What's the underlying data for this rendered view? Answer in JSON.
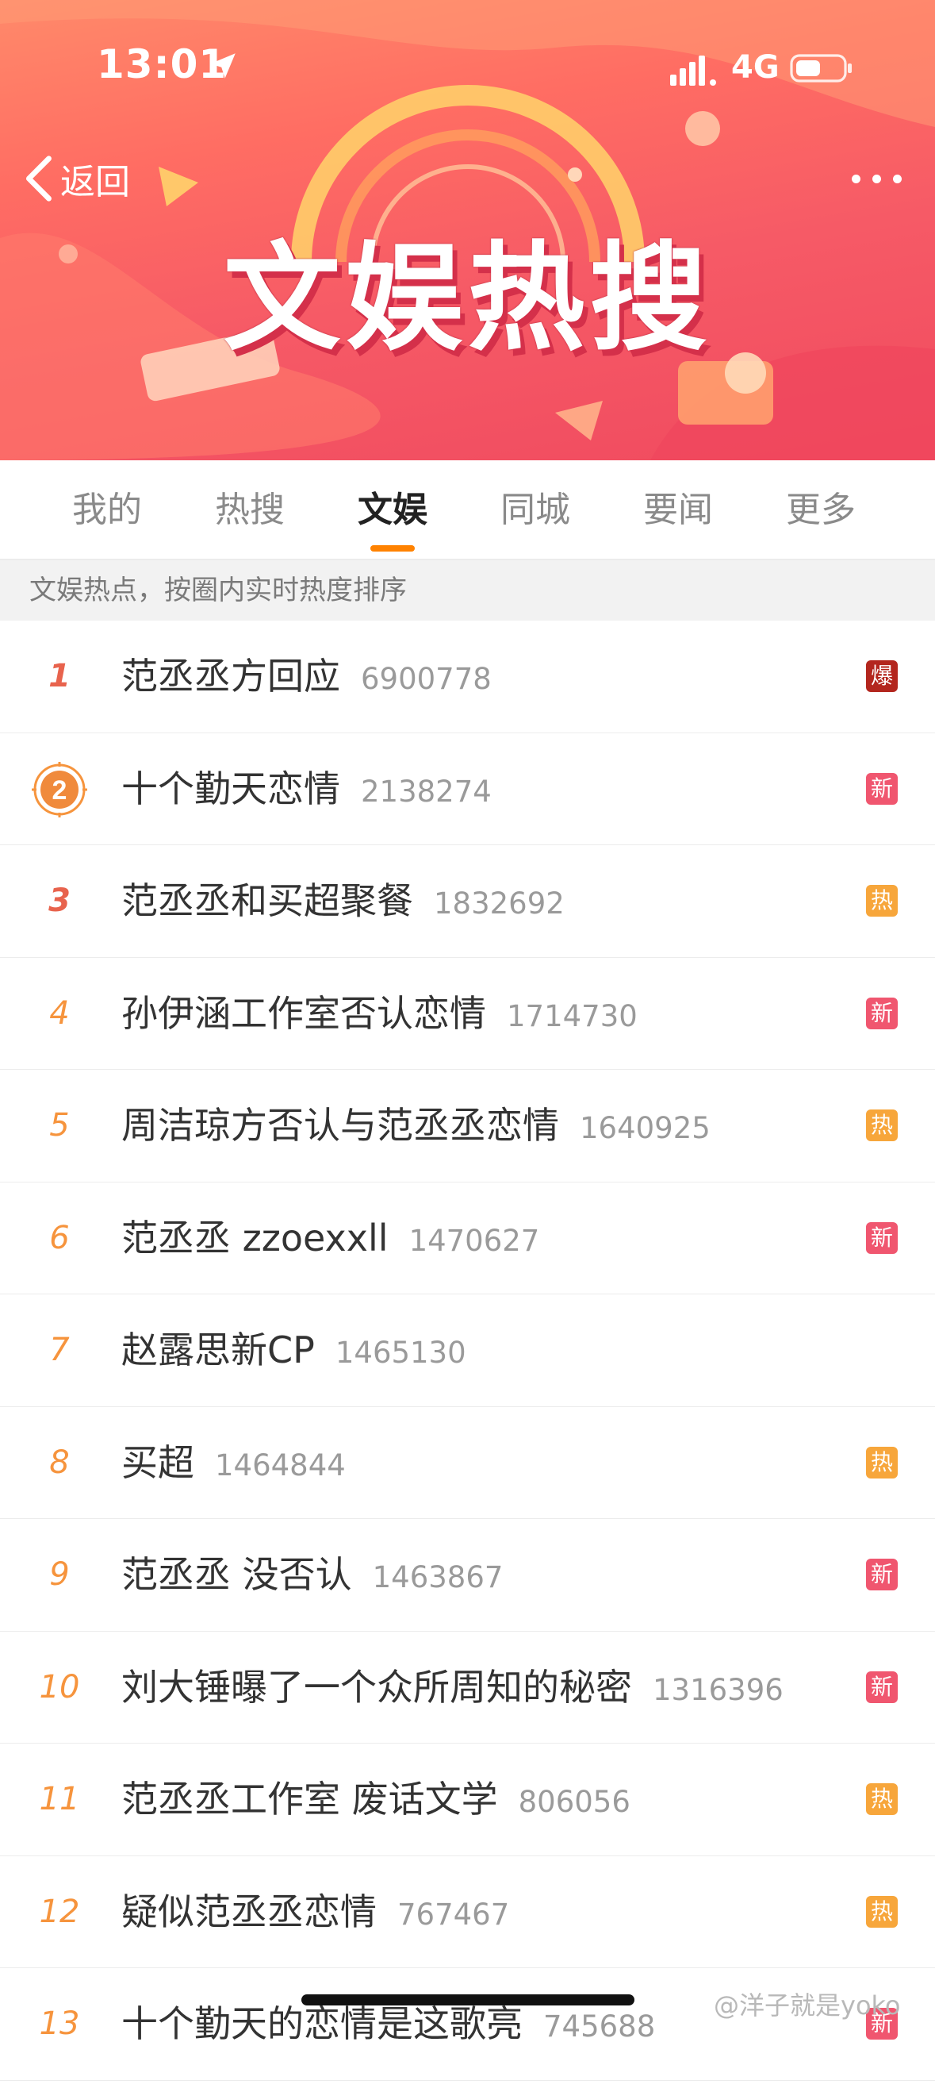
{
  "status_bar": {
    "time": "13:01",
    "network": "4G"
  },
  "header": {
    "back_label": "返回",
    "banner_title": "文娱热搜"
  },
  "tabs": [
    {
      "label": "我的",
      "active": false
    },
    {
      "label": "热搜",
      "active": false
    },
    {
      "label": "文娱",
      "active": true
    },
    {
      "label": "同城",
      "active": false
    },
    {
      "label": "要闻",
      "active": false
    },
    {
      "label": "更多",
      "active": false
    }
  ],
  "subheader": "文娱热点，按圈内实时热度排序",
  "colors": {
    "accent": "#ff8200",
    "badge_bao": "#b3261e",
    "badge_xin": "#f0566f",
    "badge_re": "#f7a63b"
  },
  "list": [
    {
      "rank": "1",
      "title": "范丞丞方回应",
      "heat": "6900778",
      "badge": "爆"
    },
    {
      "rank": "2",
      "title": "十个勤天恋情",
      "heat": "2138274",
      "badge": "新"
    },
    {
      "rank": "3",
      "title": "范丞丞和买超聚餐",
      "heat": "1832692",
      "badge": "热"
    },
    {
      "rank": "4",
      "title": "孙伊涵工作室否认恋情",
      "heat": "1714730",
      "badge": "新"
    },
    {
      "rank": "5",
      "title": "周洁琼方否认与范丞丞恋情",
      "heat": "1640925",
      "badge": "热"
    },
    {
      "rank": "6",
      "title": "范丞丞 zzoexxll",
      "heat": "1470627",
      "badge": "新"
    },
    {
      "rank": "7",
      "title": "赵露思新CP",
      "heat": "1465130",
      "badge": ""
    },
    {
      "rank": "8",
      "title": "买超",
      "heat": "1464844",
      "badge": "热"
    },
    {
      "rank": "9",
      "title": "范丞丞 没否认",
      "heat": "1463867",
      "badge": "新"
    },
    {
      "rank": "10",
      "title": "刘大锤曝了一个众所周知的秘密",
      "heat": "1316396",
      "badge": "新"
    },
    {
      "rank": "11",
      "title": "范丞丞工作室 废话文学",
      "heat": "806056",
      "badge": "热"
    },
    {
      "rank": "12",
      "title": "疑似范丞丞恋情",
      "heat": "767467",
      "badge": "热"
    },
    {
      "rank": "13",
      "title": "十个勤天的恋情是这歌亮",
      "heat": "745688",
      "badge": "新"
    }
  ],
  "watermark": "@洋子就是yoko"
}
